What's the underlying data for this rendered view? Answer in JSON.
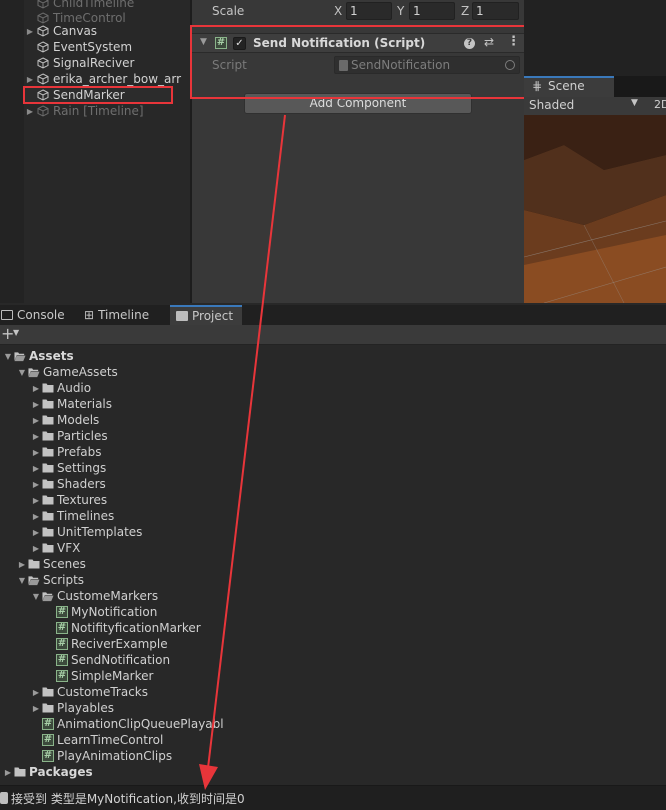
{
  "hierarchy": {
    "items": [
      {
        "label": "ChildTimeline",
        "dim": true,
        "fold": false
      },
      {
        "label": "TimeControl",
        "dim": true,
        "fold": false
      },
      {
        "label": "Canvas",
        "dim": false,
        "fold": true
      },
      {
        "label": "EventSystem",
        "dim": false,
        "fold": false
      },
      {
        "label": "SignalReciver",
        "dim": false,
        "fold": false
      },
      {
        "label": "erika_archer_bow_arr",
        "dim": false,
        "fold": true
      },
      {
        "label": "SendMarker",
        "dim": false,
        "fold": false,
        "selected": true
      },
      {
        "label": "Rain [Timeline]",
        "dim": true,
        "fold": true
      }
    ]
  },
  "inspector": {
    "scale_label": "Scale",
    "scale_x_label": "X",
    "scale_x": "1",
    "scale_y_label": "Y",
    "scale_y": "1",
    "scale_z_label": "Z",
    "scale_z": "1",
    "component_title": "Send Notification (Script)",
    "script_label": "Script",
    "script_value": "SendNotification",
    "add_component": "Add Component"
  },
  "scene": {
    "tab_label": "Scene",
    "shading_mode": "Shaded",
    "mode_2d": "2D"
  },
  "tabs": {
    "console": "Console",
    "timeline": "Timeline",
    "project": "Project"
  },
  "project": {
    "rows": [
      {
        "label": "Assets",
        "bold": true,
        "indent": 0,
        "fold": "open",
        "icon": "folder-open"
      },
      {
        "label": "GameAssets",
        "indent": 1,
        "fold": "open",
        "icon": "folder-open"
      },
      {
        "label": "Audio",
        "indent": 2,
        "fold": "closed",
        "icon": "folder"
      },
      {
        "label": "Materials",
        "indent": 2,
        "fold": "closed",
        "icon": "folder"
      },
      {
        "label": "Models",
        "indent": 2,
        "fold": "closed",
        "icon": "folder"
      },
      {
        "label": "Particles",
        "indent": 2,
        "fold": "closed",
        "icon": "folder"
      },
      {
        "label": "Prefabs",
        "indent": 2,
        "fold": "closed",
        "icon": "folder"
      },
      {
        "label": "Settings",
        "indent": 2,
        "fold": "closed",
        "icon": "folder"
      },
      {
        "label": "Shaders",
        "indent": 2,
        "fold": "closed",
        "icon": "folder"
      },
      {
        "label": "Textures",
        "indent": 2,
        "fold": "closed",
        "icon": "folder"
      },
      {
        "label": "Timelines",
        "indent": 2,
        "fold": "closed",
        "icon": "folder"
      },
      {
        "label": "UnitTemplates",
        "indent": 2,
        "fold": "closed",
        "icon": "folder"
      },
      {
        "label": "VFX",
        "indent": 2,
        "fold": "closed",
        "icon": "folder"
      },
      {
        "label": "Scenes",
        "indent": 1,
        "fold": "closed",
        "icon": "folder"
      },
      {
        "label": "Scripts",
        "indent": 1,
        "fold": "open",
        "icon": "folder-open"
      },
      {
        "label": "CustomeMarkers",
        "indent": 2,
        "fold": "open",
        "icon": "folder-open"
      },
      {
        "label": "MyNotification",
        "indent": 3,
        "fold": "none",
        "icon": "csharp"
      },
      {
        "label": "NotifityficationMarker",
        "indent": 3,
        "fold": "none",
        "icon": "csharp"
      },
      {
        "label": "ReciverExample",
        "indent": 3,
        "fold": "none",
        "icon": "csharp"
      },
      {
        "label": "SendNotification",
        "indent": 3,
        "fold": "none",
        "icon": "csharp"
      },
      {
        "label": "SimpleMarker",
        "indent": 3,
        "fold": "none",
        "icon": "csharp"
      },
      {
        "label": "CustomeTracks",
        "indent": 2,
        "fold": "closed",
        "icon": "folder"
      },
      {
        "label": "Playables",
        "indent": 2,
        "fold": "closed",
        "icon": "folder"
      },
      {
        "label": "AnimationClipQueuePlayabl",
        "indent": 2,
        "fold": "none",
        "icon": "csharp"
      },
      {
        "label": "LearnTimeControl",
        "indent": 2,
        "fold": "none",
        "icon": "csharp"
      },
      {
        "label": "PlayAnimationClips",
        "indent": 2,
        "fold": "none",
        "icon": "csharp"
      },
      {
        "label": "Packages",
        "bold": true,
        "indent": 0,
        "fold": "closed",
        "icon": "folder"
      }
    ]
  },
  "status": {
    "message": "接受到 类型是MyNotification,收到时间是0"
  },
  "colors": {
    "annotation": "#e8353a",
    "accent": "#3a79bb"
  },
  "icons": {
    "hierarchy_item": "gameobject-cube-icon",
    "script": "csharp-script-icon",
    "help": "help-icon",
    "presets": "presets-icon",
    "menu": "kebab-menu-icon"
  }
}
